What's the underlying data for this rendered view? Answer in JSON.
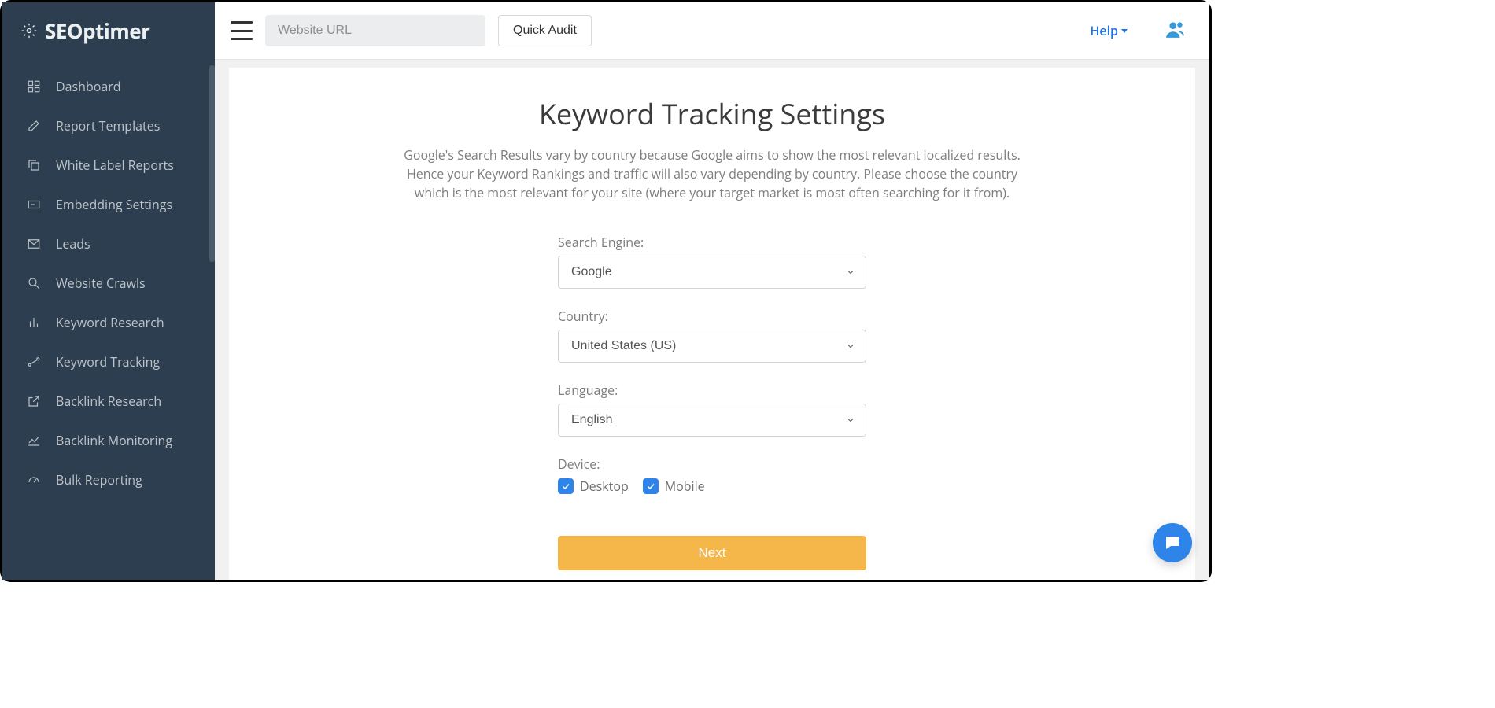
{
  "brand": {
    "name": "SEOptimer"
  },
  "sidebar": {
    "items": [
      {
        "label": "Dashboard"
      },
      {
        "label": "Report Templates"
      },
      {
        "label": "White Label Reports"
      },
      {
        "label": "Embedding Settings"
      },
      {
        "label": "Leads"
      },
      {
        "label": "Website Crawls"
      },
      {
        "label": "Keyword Research"
      },
      {
        "label": "Keyword Tracking"
      },
      {
        "label": "Backlink Research"
      },
      {
        "label": "Backlink Monitoring"
      },
      {
        "label": "Bulk Reporting"
      }
    ]
  },
  "topbar": {
    "url_placeholder": "Website URL",
    "quick_audit": "Quick Audit",
    "help": "Help"
  },
  "page": {
    "title": "Keyword Tracking Settings",
    "description": "Google's Search Results vary by country because Google aims to show the most relevant localized results. Hence your Keyword Rankings and traffic will also vary depending by country. Please choose the country which is the most relevant for your site (where your target market is most often searching for it from).",
    "form": {
      "search_engine_label": "Search Engine:",
      "search_engine_value": "Google",
      "country_label": "Country:",
      "country_value": "United States (US)",
      "language_label": "Language:",
      "language_value": "English",
      "device_label": "Device:",
      "device_desktop": "Desktop",
      "device_mobile": "Mobile",
      "next": "Next"
    }
  },
  "colors": {
    "sidebar_bg": "#2c3e50",
    "accent_blue": "#2f84ea",
    "accent_yellow": "#f6b74a"
  }
}
